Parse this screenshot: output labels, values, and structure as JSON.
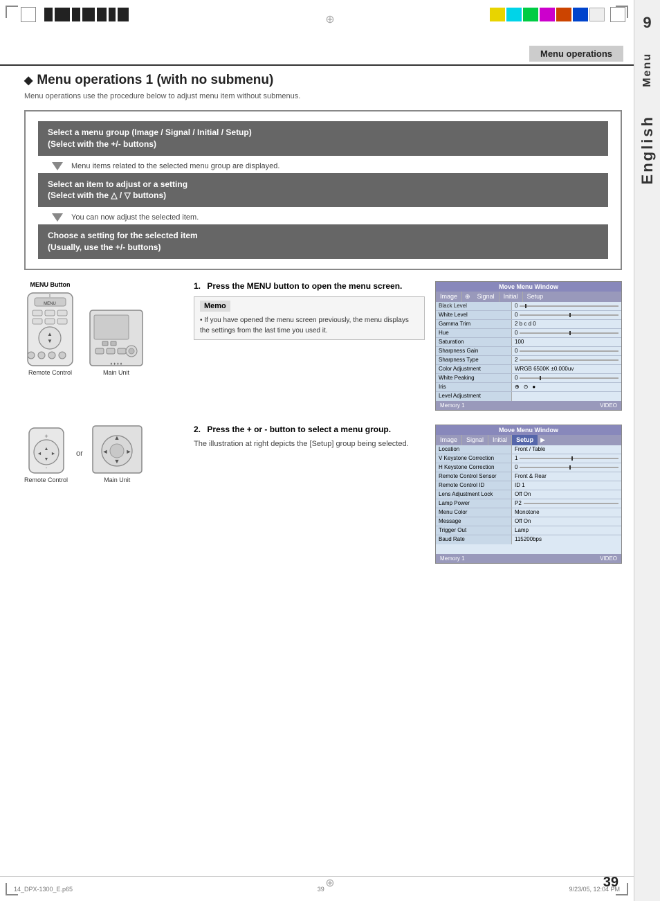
{
  "header": {
    "title": "Menu operations"
  },
  "page": {
    "title": "Menu operations 1 (with no submenu)",
    "subtitle": "Menu operations use the procedure below to adjust menu item without submenus."
  },
  "steps_box": {
    "step1": {
      "text": "Select a menu group (Image / Signal / Initial / Setup)\n(Select with the +/- buttons)"
    },
    "step1_desc": "Menu items related to the selected menu group are displayed.",
    "step2": {
      "text": "Select an item to adjust or a setting\n(Select with the △ / ▽ buttons)"
    },
    "step2_desc": "You can now adjust the selected item.",
    "step3": {
      "text": "Choose a setting for the selected item\n(Usually, use the +/- buttons)"
    }
  },
  "section1": {
    "step_num": "1.",
    "step_desc": "Press the MENU button to open the menu screen.",
    "memo_title": "Memo",
    "memo_text": "If you have opened the menu screen previously, the menu displays the settings from the last time you used it.",
    "menu_button_label": "MENU Button",
    "remote_label": "Remote Control",
    "main_unit_label": "Main Unit"
  },
  "section2": {
    "step_num": "2.",
    "step_desc": "Press the + or - button to select a menu group.",
    "group_desc": "The illustration at right depicts the [Setup] group being selected.",
    "remote_label": "Remote Control",
    "main_unit_label": "Main Unit"
  },
  "menu_window_1": {
    "title": "Move Menu Window",
    "tabs": [
      "Image",
      "Signal",
      "Initial",
      "Setup"
    ],
    "rows": [
      {
        "label": "Black Level",
        "value": "0"
      },
      {
        "label": "White Level",
        "value": "0"
      },
      {
        "label": "Gamma Trim",
        "value": "2"
      },
      {
        "label": "Hue",
        "value": "0"
      },
      {
        "label": "Saturation",
        "value": "100"
      },
      {
        "label": "Sharpness Gain",
        "value": "0"
      },
      {
        "label": "Sharpness Type",
        "value": "2"
      },
      {
        "label": "Color Adjustment",
        "value": "WRGB  6500K ±0.000uv"
      },
      {
        "label": "White Peaking",
        "value": "0"
      },
      {
        "label": "Iris",
        "value": ""
      },
      {
        "label": "Level Adjustment",
        "value": ""
      }
    ],
    "footer_left": "Memory 1",
    "footer_right": "VIDEO"
  },
  "menu_window_2": {
    "title": "Move Menu Window",
    "tabs": [
      "Image",
      "Signal",
      "Initial",
      "Setup"
    ],
    "rows": [
      {
        "label": "Location",
        "value": "Front / Table"
      },
      {
        "label": "V Keystone Correction",
        "value": "1"
      },
      {
        "label": "H Keystone Correction",
        "value": "0"
      },
      {
        "label": "Remote Control Sensor",
        "value": "Front & Rear"
      },
      {
        "label": "Remote Control ID",
        "value": "ID 1"
      },
      {
        "label": "Lens Adjustment Lock",
        "value": "Off   On"
      },
      {
        "label": "Lamp Power",
        "value": "P2"
      },
      {
        "label": "Menu Color",
        "value": "Monotone"
      },
      {
        "label": "Message",
        "value": "Off   On"
      },
      {
        "label": "Trigger Out",
        "value": "Lamp"
      },
      {
        "label": "Baud Rate",
        "value": "115200bps"
      }
    ],
    "footer_left": "Memory 1",
    "footer_right": "VIDEO"
  },
  "footer": {
    "left_text": "14_DPX-1300_E.p65",
    "center_text": "39",
    "right_text": "9/23/05, 12:04 PM"
  },
  "page_number": "39",
  "sidebar": {
    "menu_label": "Menu",
    "number": "9",
    "english_label": "English"
  },
  "colors": {
    "step_box_bg": "#555555",
    "header_bg": "#e0e0e0",
    "sidebar_bg": "#f0f0f0",
    "menu_tab_bg": "#7777aa",
    "menu_body_bg": "#dce6f0"
  }
}
